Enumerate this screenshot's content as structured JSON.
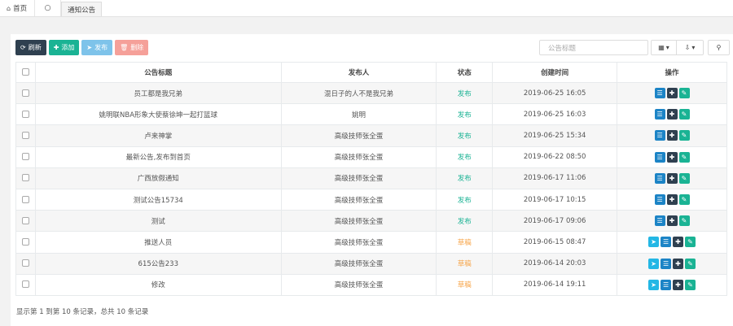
{
  "tabs": [
    {
      "label": "首页",
      "icon": "home-icon"
    },
    {
      "label": "",
      "icon": "refresh-circle-icon"
    },
    {
      "label": "通知公告",
      "icon": ""
    }
  ],
  "toolbar": {
    "refresh_label": "刷新",
    "add_label": "添加",
    "publish_label": "发布",
    "delete_label": "删除"
  },
  "search": {
    "placeholder": "公告标题"
  },
  "table": {
    "headers": [
      "公告标题",
      "发布人",
      "状态",
      "创建时间",
      "操作"
    ],
    "rows": [
      {
        "title": "员工都是我兄弟",
        "publisher": "混日子的人不是我兄弟",
        "status": "发布",
        "created": "2019-06-25 16:05",
        "draft": false
      },
      {
        "title": "姚明联NBA形象大使蔡徐坤一起打篮球",
        "publisher": "姚明",
        "status": "发布",
        "created": "2019-06-25 16:03",
        "draft": false
      },
      {
        "title": "卢来神掌",
        "publisher": "高级技师张全蛋",
        "status": "发布",
        "created": "2019-06-25 15:34",
        "draft": false
      },
      {
        "title": "最新公告,发布到首页",
        "publisher": "高级技师张全蛋",
        "status": "发布",
        "created": "2019-06-22 08:50",
        "draft": false
      },
      {
        "title": "广西放假通知",
        "publisher": "高级技师张全蛋",
        "status": "发布",
        "created": "2019-06-17 11:06",
        "draft": false
      },
      {
        "title": "测试公告15734",
        "publisher": "高级技师张全蛋",
        "status": "发布",
        "created": "2019-06-17 10:15",
        "draft": false
      },
      {
        "title": "测试",
        "publisher": "高级技师张全蛋",
        "status": "发布",
        "created": "2019-06-17 09:06",
        "draft": false
      },
      {
        "title": "推送人员",
        "publisher": "高级技师张全蛋",
        "status": "草稿",
        "created": "2019-06-15 08:47",
        "draft": true
      },
      {
        "title": "615公告233",
        "publisher": "高级技师张全蛋",
        "status": "草稿",
        "created": "2019-06-14 20:03",
        "draft": true
      },
      {
        "title": "修改",
        "publisher": "高级技师张全蛋",
        "status": "草稿",
        "created": "2019-06-14 19:11",
        "draft": true
      }
    ]
  },
  "footer": {
    "text": "显示第 1 到第 10 条记录，总共 10 条记录"
  }
}
